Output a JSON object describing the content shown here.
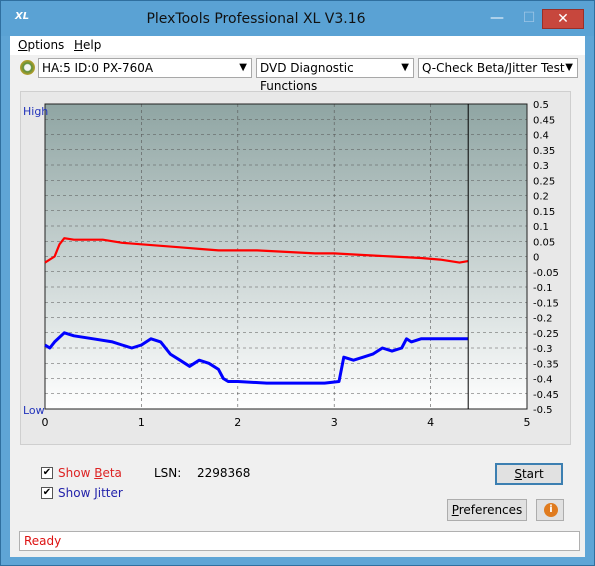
{
  "window": {
    "title": "PlexTools Professional XL V3.16",
    "app_icon": "XL"
  },
  "menu": [
    {
      "label": "Options",
      "mnemonic": "O",
      "rest": "ptions"
    },
    {
      "label": "Help",
      "mnemonic": "H",
      "rest": "elp"
    }
  ],
  "toolbar": {
    "drive": "HA:5 ID:0  PX-760A",
    "function": "DVD Diagnostic Functions",
    "test": "Q-Check Beta/Jitter Test"
  },
  "chart_data": {
    "type": "line",
    "x_ticks": [
      "0",
      "1",
      "2",
      "3",
      "4",
      "5"
    ],
    "xlim": [
      0,
      5
    ],
    "y_right_ticks": [
      "0.5",
      "0.45",
      "0.4",
      "0.35",
      "0.3",
      "0.25",
      "0.2",
      "0.15",
      "0.1",
      "0.05",
      "0",
      "-0.05",
      "-0.1",
      "-0.15",
      "-0.2",
      "-0.25",
      "-0.3",
      "-0.35",
      "-0.4",
      "-0.45",
      "-0.5"
    ],
    "ylim": [
      -0.5,
      0.5
    ],
    "left_axis_top": "High",
    "left_axis_bottom": "Low",
    "end_marker_x": 4.39,
    "background_colors": {
      "top": "#8fa5a3",
      "bottom": "#ffffff"
    },
    "series": [
      {
        "color": "#ff0000",
        "x": [
          0.0,
          0.1,
          0.15,
          0.2,
          0.3,
          0.5,
          0.6,
          0.8,
          1.0,
          1.2,
          1.4,
          1.6,
          1.8,
          2.0,
          2.2,
          2.5,
          2.8,
          3.0,
          3.3,
          3.6,
          3.9,
          4.1,
          4.2,
          4.3,
          4.39
        ],
        "y": [
          -0.02,
          0.0,
          0.04,
          0.06,
          0.055,
          0.055,
          0.055,
          0.045,
          0.04,
          0.035,
          0.03,
          0.025,
          0.02,
          0.02,
          0.02,
          0.015,
          0.01,
          0.01,
          0.005,
          0.0,
          -0.005,
          -0.01,
          -0.015,
          -0.02,
          -0.015
        ]
      },
      {
        "color": "#0000ff",
        "x": [
          0.0,
          0.05,
          0.1,
          0.2,
          0.3,
          0.5,
          0.7,
          0.8,
          0.9,
          1.0,
          1.1,
          1.2,
          1.3,
          1.4,
          1.5,
          1.6,
          1.7,
          1.8,
          1.85,
          1.9,
          2.0,
          2.3,
          2.6,
          2.9,
          3.05,
          3.1,
          3.2,
          3.3,
          3.4,
          3.5,
          3.6,
          3.7,
          3.75,
          3.8,
          3.9,
          4.0,
          4.2,
          4.39
        ],
        "y": [
          -0.29,
          -0.3,
          -0.28,
          -0.25,
          -0.26,
          -0.27,
          -0.28,
          -0.29,
          -0.3,
          -0.29,
          -0.27,
          -0.28,
          -0.32,
          -0.34,
          -0.36,
          -0.34,
          -0.35,
          -0.37,
          -0.4,
          -0.41,
          -0.41,
          -0.415,
          -0.415,
          -0.415,
          -0.41,
          -0.33,
          -0.34,
          -0.33,
          -0.32,
          -0.3,
          -0.31,
          -0.3,
          -0.27,
          -0.28,
          -0.27,
          -0.27,
          -0.27,
          -0.27
        ]
      }
    ]
  },
  "controls": {
    "show_beta": {
      "label_pre": "Show ",
      "mnemonic": "B",
      "label_post": "eta",
      "checked": true
    },
    "show_jitter": {
      "label_pre": "Show ",
      "mnemonic": "J",
      "label_post": "itter",
      "checked": true
    },
    "lsn_label": "LSN:",
    "lsn_value": "2298368",
    "start_mnemonic": "S",
    "start_rest": "tart",
    "preferences_mnemonic": "P",
    "preferences_rest": "references"
  },
  "status": {
    "text": "Ready",
    "color": "#dd1111"
  }
}
